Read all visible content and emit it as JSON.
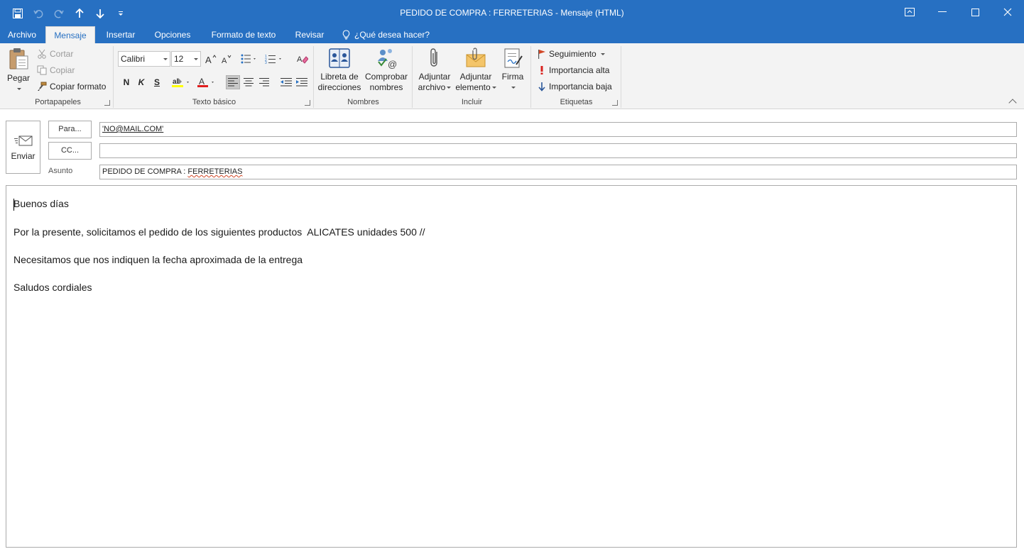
{
  "window": {
    "title": "PEDIDO DE COMPRA : FERRETERIAS - Mensaje (HTML)"
  },
  "tabs": [
    {
      "label": "Archivo"
    },
    {
      "label": "Mensaje"
    },
    {
      "label": "Insertar"
    },
    {
      "label": "Opciones"
    },
    {
      "label": "Formato de texto"
    },
    {
      "label": "Revisar"
    }
  ],
  "tell_me": "¿Qué desea hacer?",
  "ribbon": {
    "portapapeles": {
      "label": "Portapapeles",
      "paste": "Pegar",
      "cut": "Cortar",
      "copy": "Copiar",
      "format_painter": "Copiar formato"
    },
    "texto_basico": {
      "label": "Texto básico",
      "font": "Calibri",
      "size": "12",
      "bold": "N",
      "italic": "K",
      "underline": "S"
    },
    "nombres": {
      "label": "Nombres",
      "address_book_1": "Libreta de",
      "address_book_2": "direcciones",
      "check_names_1": "Comprobar",
      "check_names_2": "nombres"
    },
    "incluir": {
      "label": "Incluir",
      "attach_file_1": "Adjuntar",
      "attach_file_2": "archivo",
      "attach_item_1": "Adjuntar",
      "attach_item_2": "elemento",
      "signature": "Firma"
    },
    "etiquetas": {
      "label": "Etiquetas",
      "follow_up": "Seguimiento",
      "high": "Importancia alta",
      "low": "Importancia baja"
    }
  },
  "header": {
    "send": "Enviar",
    "to_button": "Para...",
    "cc_button": "CC...",
    "subject_label": "Asunto",
    "to_value": "'NO@MAIL.COM'",
    "cc_value": "",
    "subject_prefix": "PEDIDO DE COMPRA : ",
    "subject_word": "FERRETERIAS"
  },
  "body": {
    "lines": [
      "Buenos días",
      "Por la presente, solicitamos el pedido de los siguientes productos  ALICATES unidades 500 //",
      "Necesitamos que nos indiquen la fecha aproximada de la entrega",
      "Saludos cordiales"
    ]
  }
}
